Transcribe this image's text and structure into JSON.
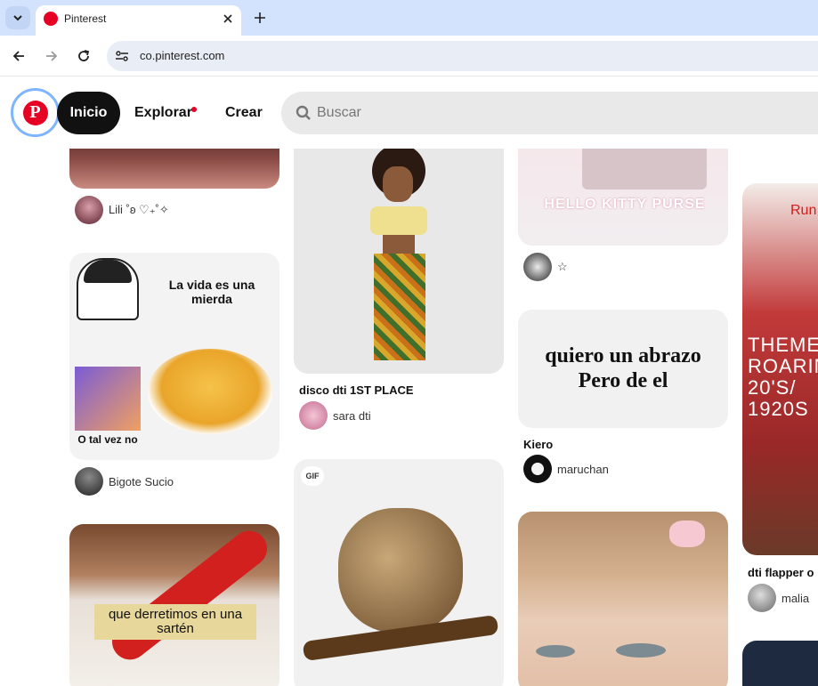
{
  "browser": {
    "tab_title": "Pinterest",
    "url": "co.pinterest.com"
  },
  "header": {
    "nav_home": "Inicio",
    "nav_explore": "Explorar",
    "nav_create": "Crear",
    "search_placeholder": "Buscar"
  },
  "pins": {
    "p1": {
      "author": "Lili ˚ʚ ♡₊˚✧"
    },
    "p2": {
      "text1": "La vida es una mierda",
      "text2": "O tal vez no",
      "author": "Bigote Sucio"
    },
    "p3": {
      "text": "que derretimos en una sartén"
    },
    "p4": {
      "title": "disco dti 1ST PLACE",
      "author": "sara dti"
    },
    "p5": {
      "badge": "GIF"
    },
    "p6": {
      "text": "HELLO KITTY PURSE",
      "author": "☆"
    },
    "p7": {
      "text": "quiero un abrazo Pero de el",
      "title": "Kiero",
      "author": "maruchan"
    },
    "p9": {
      "text_top": "Run",
      "text": "THEME: ROARING 20'S/ 1920S",
      "title": "dti flapper o",
      "author": "malia"
    }
  }
}
